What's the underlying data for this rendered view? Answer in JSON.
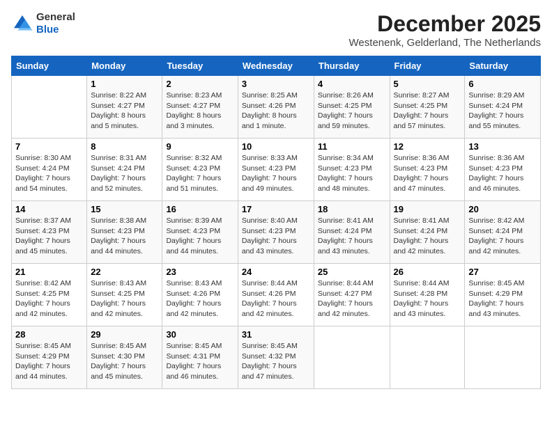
{
  "header": {
    "logo_line1": "General",
    "logo_line2": "Blue",
    "month": "December 2025",
    "location": "Westenenk, Gelderland, The Netherlands"
  },
  "days_of_week": [
    "Sunday",
    "Monday",
    "Tuesday",
    "Wednesday",
    "Thursday",
    "Friday",
    "Saturday"
  ],
  "weeks": [
    [
      {
        "day": "",
        "sunrise": "",
        "sunset": "",
        "daylight": ""
      },
      {
        "day": "1",
        "sunrise": "Sunrise: 8:22 AM",
        "sunset": "Sunset: 4:27 PM",
        "daylight": "Daylight: 8 hours and 5 minutes."
      },
      {
        "day": "2",
        "sunrise": "Sunrise: 8:23 AM",
        "sunset": "Sunset: 4:27 PM",
        "daylight": "Daylight: 8 hours and 3 minutes."
      },
      {
        "day": "3",
        "sunrise": "Sunrise: 8:25 AM",
        "sunset": "Sunset: 4:26 PM",
        "daylight": "Daylight: 8 hours and 1 minute."
      },
      {
        "day": "4",
        "sunrise": "Sunrise: 8:26 AM",
        "sunset": "Sunset: 4:25 PM",
        "daylight": "Daylight: 7 hours and 59 minutes."
      },
      {
        "day": "5",
        "sunrise": "Sunrise: 8:27 AM",
        "sunset": "Sunset: 4:25 PM",
        "daylight": "Daylight: 7 hours and 57 minutes."
      },
      {
        "day": "6",
        "sunrise": "Sunrise: 8:29 AM",
        "sunset": "Sunset: 4:24 PM",
        "daylight": "Daylight: 7 hours and 55 minutes."
      }
    ],
    [
      {
        "day": "7",
        "sunrise": "Sunrise: 8:30 AM",
        "sunset": "Sunset: 4:24 PM",
        "daylight": "Daylight: 7 hours and 54 minutes."
      },
      {
        "day": "8",
        "sunrise": "Sunrise: 8:31 AM",
        "sunset": "Sunset: 4:24 PM",
        "daylight": "Daylight: 7 hours and 52 minutes."
      },
      {
        "day": "9",
        "sunrise": "Sunrise: 8:32 AM",
        "sunset": "Sunset: 4:23 PM",
        "daylight": "Daylight: 7 hours and 51 minutes."
      },
      {
        "day": "10",
        "sunrise": "Sunrise: 8:33 AM",
        "sunset": "Sunset: 4:23 PM",
        "daylight": "Daylight: 7 hours and 49 minutes."
      },
      {
        "day": "11",
        "sunrise": "Sunrise: 8:34 AM",
        "sunset": "Sunset: 4:23 PM",
        "daylight": "Daylight: 7 hours and 48 minutes."
      },
      {
        "day": "12",
        "sunrise": "Sunrise: 8:36 AM",
        "sunset": "Sunset: 4:23 PM",
        "daylight": "Daylight: 7 hours and 47 minutes."
      },
      {
        "day": "13",
        "sunrise": "Sunrise: 8:36 AM",
        "sunset": "Sunset: 4:23 PM",
        "daylight": "Daylight: 7 hours and 46 minutes."
      }
    ],
    [
      {
        "day": "14",
        "sunrise": "Sunrise: 8:37 AM",
        "sunset": "Sunset: 4:23 PM",
        "daylight": "Daylight: 7 hours and 45 minutes."
      },
      {
        "day": "15",
        "sunrise": "Sunrise: 8:38 AM",
        "sunset": "Sunset: 4:23 PM",
        "daylight": "Daylight: 7 hours and 44 minutes."
      },
      {
        "day": "16",
        "sunrise": "Sunrise: 8:39 AM",
        "sunset": "Sunset: 4:23 PM",
        "daylight": "Daylight: 7 hours and 44 minutes."
      },
      {
        "day": "17",
        "sunrise": "Sunrise: 8:40 AM",
        "sunset": "Sunset: 4:23 PM",
        "daylight": "Daylight: 7 hours and 43 minutes."
      },
      {
        "day": "18",
        "sunrise": "Sunrise: 8:41 AM",
        "sunset": "Sunset: 4:24 PM",
        "daylight": "Daylight: 7 hours and 43 minutes."
      },
      {
        "day": "19",
        "sunrise": "Sunrise: 8:41 AM",
        "sunset": "Sunset: 4:24 PM",
        "daylight": "Daylight: 7 hours and 42 minutes."
      },
      {
        "day": "20",
        "sunrise": "Sunrise: 8:42 AM",
        "sunset": "Sunset: 4:24 PM",
        "daylight": "Daylight: 7 hours and 42 minutes."
      }
    ],
    [
      {
        "day": "21",
        "sunrise": "Sunrise: 8:42 AM",
        "sunset": "Sunset: 4:25 PM",
        "daylight": "Daylight: 7 hours and 42 minutes."
      },
      {
        "day": "22",
        "sunrise": "Sunrise: 8:43 AM",
        "sunset": "Sunset: 4:25 PM",
        "daylight": "Daylight: 7 hours and 42 minutes."
      },
      {
        "day": "23",
        "sunrise": "Sunrise: 8:43 AM",
        "sunset": "Sunset: 4:26 PM",
        "daylight": "Daylight: 7 hours and 42 minutes."
      },
      {
        "day": "24",
        "sunrise": "Sunrise: 8:44 AM",
        "sunset": "Sunset: 4:26 PM",
        "daylight": "Daylight: 7 hours and 42 minutes."
      },
      {
        "day": "25",
        "sunrise": "Sunrise: 8:44 AM",
        "sunset": "Sunset: 4:27 PM",
        "daylight": "Daylight: 7 hours and 42 minutes."
      },
      {
        "day": "26",
        "sunrise": "Sunrise: 8:44 AM",
        "sunset": "Sunset: 4:28 PM",
        "daylight": "Daylight: 7 hours and 43 minutes."
      },
      {
        "day": "27",
        "sunrise": "Sunrise: 8:45 AM",
        "sunset": "Sunset: 4:29 PM",
        "daylight": "Daylight: 7 hours and 43 minutes."
      }
    ],
    [
      {
        "day": "28",
        "sunrise": "Sunrise: 8:45 AM",
        "sunset": "Sunset: 4:29 PM",
        "daylight": "Daylight: 7 hours and 44 minutes."
      },
      {
        "day": "29",
        "sunrise": "Sunrise: 8:45 AM",
        "sunset": "Sunset: 4:30 PM",
        "daylight": "Daylight: 7 hours and 45 minutes."
      },
      {
        "day": "30",
        "sunrise": "Sunrise: 8:45 AM",
        "sunset": "Sunset: 4:31 PM",
        "daylight": "Daylight: 7 hours and 46 minutes."
      },
      {
        "day": "31",
        "sunrise": "Sunrise: 8:45 AM",
        "sunset": "Sunset: 4:32 PM",
        "daylight": "Daylight: 7 hours and 47 minutes."
      },
      {
        "day": "",
        "sunrise": "",
        "sunset": "",
        "daylight": ""
      },
      {
        "day": "",
        "sunrise": "",
        "sunset": "",
        "daylight": ""
      },
      {
        "day": "",
        "sunrise": "",
        "sunset": "",
        "daylight": ""
      }
    ]
  ]
}
